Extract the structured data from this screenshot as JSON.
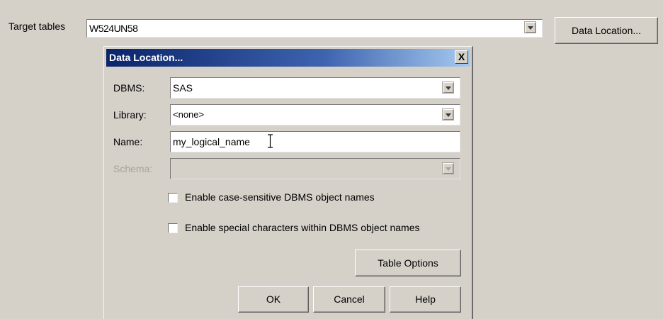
{
  "main": {
    "target_tables_label": "Target tables",
    "target_tables_value": "W524UN58",
    "data_location_button": "Data Location..."
  },
  "dialog": {
    "title": "Data Location...",
    "close_label": "X",
    "dbms_label": "DBMS:",
    "dbms_value": "SAS",
    "library_label": "Library:",
    "library_value": "<none>",
    "name_label": "Name:",
    "name_value": "my_logical_name",
    "schema_label": "Schema:",
    "schema_value": "",
    "case_sensitive_label": "Enable case-sensitive DBMS object names",
    "case_sensitive_checked": false,
    "special_chars_label": "Enable special characters within DBMS object names",
    "special_chars_checked": false,
    "table_options_button": "Table Options",
    "ok_button": "OK",
    "cancel_button": "Cancel",
    "help_button": "Help"
  },
  "colors": {
    "background": "#d5d0c8",
    "titlebar_start": "#0a246a",
    "titlebar_end": "#a6caf0",
    "disabled_text": "#a6a29b"
  }
}
